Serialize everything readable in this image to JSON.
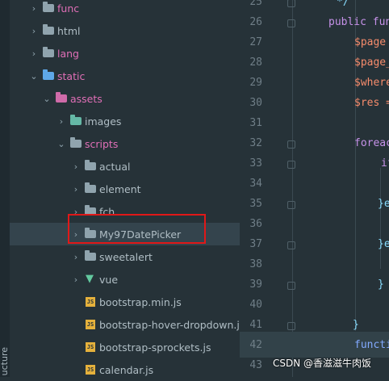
{
  "tool_window": {
    "side_label": "ucture"
  },
  "tree": [
    {
      "name": "func",
      "kind": "folder",
      "arrow": "›",
      "indent": 36,
      "labelColor": "pink",
      "icon": "folder"
    },
    {
      "name": "html",
      "kind": "folder",
      "arrow": "›",
      "indent": 36,
      "labelColor": "plain",
      "icon": "folder"
    },
    {
      "name": "lang",
      "kind": "folder",
      "arrow": "›",
      "indent": 36,
      "labelColor": "pink",
      "icon": "folder"
    },
    {
      "name": "static",
      "kind": "folder",
      "arrow": "⌄",
      "indent": 36,
      "labelColor": "pink",
      "icon": "blue-folder"
    },
    {
      "name": "assets",
      "kind": "folder",
      "arrow": "⌄",
      "indent": 52,
      "labelColor": "pink",
      "icon": "pink-folder"
    },
    {
      "name": "images",
      "kind": "folder",
      "arrow": "›",
      "indent": 70,
      "labelColor": "plain",
      "icon": "green-folder"
    },
    {
      "name": "scripts",
      "kind": "folder",
      "arrow": "⌄",
      "indent": 70,
      "labelColor": "pink",
      "icon": "folder"
    },
    {
      "name": "actual",
      "kind": "folder",
      "arrow": "›",
      "indent": 88,
      "labelColor": "plain",
      "icon": "folder"
    },
    {
      "name": "element",
      "kind": "folder",
      "arrow": "›",
      "indent": 88,
      "labelColor": "plain",
      "icon": "folder"
    },
    {
      "name": "fch",
      "kind": "folder",
      "arrow": "›",
      "indent": 88,
      "labelColor": "plain",
      "icon": "folder"
    },
    {
      "name": "My97DatePicker",
      "kind": "folder",
      "arrow": "›",
      "indent": 88,
      "labelColor": "plain",
      "icon": "gray-folder",
      "hover": true
    },
    {
      "name": "sweetalert",
      "kind": "folder",
      "arrow": "›",
      "indent": 88,
      "labelColor": "plain",
      "icon": "folder"
    },
    {
      "name": "vue",
      "kind": "folder",
      "arrow": "›",
      "indent": 88,
      "labelColor": "plain",
      "icon": "vue"
    },
    {
      "name": "bootstrap.min.js",
      "kind": "file",
      "arrow": "",
      "indent": 100,
      "labelColor": "plain",
      "icon": "js"
    },
    {
      "name": "bootstrap-hover-dropdown.js",
      "kind": "file",
      "arrow": "",
      "indent": 100,
      "labelColor": "plain",
      "icon": "js"
    },
    {
      "name": "bootstrap-sprockets.js",
      "kind": "file",
      "arrow": "",
      "indent": 100,
      "labelColor": "plain",
      "icon": "js"
    },
    {
      "name": "calendar.js",
      "kind": "file",
      "arrow": "",
      "indent": 100,
      "labelColor": "plain",
      "icon": "js"
    }
  ],
  "code": [
    {
      "line": "25",
      "text": "*/",
      "class": "punc"
    },
    {
      "line": "26",
      "text": "public fun",
      "class": "kw"
    },
    {
      "line": "27",
      "text": "$page",
      "class": "var"
    },
    {
      "line": "28",
      "text": "$page_",
      "class": "var"
    },
    {
      "line": "29",
      "text": "$where",
      "class": "var"
    },
    {
      "line": "30",
      "text": "$res =",
      "class": "var"
    },
    {
      "line": "31",
      "text": "",
      "class": ""
    },
    {
      "line": "32",
      "text": "foreac",
      "class": "kw"
    },
    {
      "line": "33",
      "text": "if",
      "class": "kw"
    },
    {
      "line": "34",
      "text": "",
      "class": ""
    },
    {
      "line": "35",
      "text": "}e",
      "class": "punc"
    },
    {
      "line": "36",
      "text": "",
      "class": ""
    },
    {
      "line": "37",
      "text": "}e",
      "class": "punc"
    },
    {
      "line": "38",
      "text": "",
      "class": ""
    },
    {
      "line": "39",
      "text": "}",
      "class": "punc"
    },
    {
      "line": "40",
      "text": "",
      "class": ""
    },
    {
      "line": "41",
      "text": "}",
      "class": "punc"
    },
    {
      "line": "42",
      "text": "functi",
      "class": "fn"
    },
    {
      "line": "43",
      "text": "",
      "class": ""
    }
  ],
  "watermark": "CSDN @香滋滋牛肉饭"
}
